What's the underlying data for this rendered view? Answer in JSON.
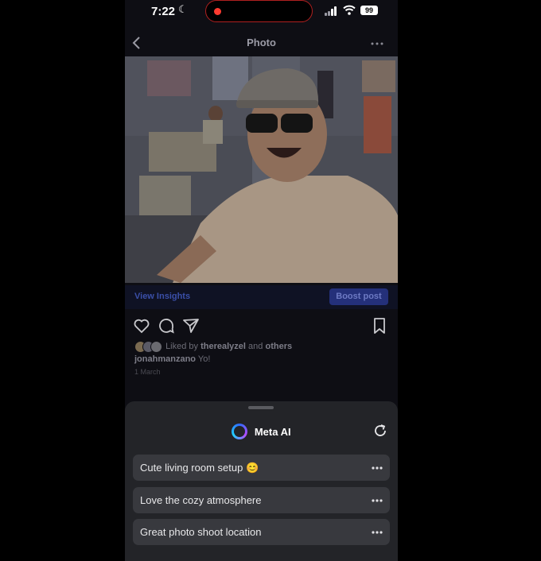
{
  "status_bar": {
    "time": "7:22",
    "battery": "99"
  },
  "nav": {
    "title": "Photo",
    "back_icon": "chevron-left-icon",
    "more_icon": "more-horizontal-icon"
  },
  "post": {
    "view_insights": "View Insights",
    "boost_post": "Boost post",
    "likes_prefix": "Liked by",
    "liked_by_user": "therealyzel",
    "likes_joiner": "and",
    "likes_others": "others",
    "caption_user": "jonahmanzano",
    "caption_text": "Yo!",
    "date": "1 March"
  },
  "meta_ai": {
    "title": "Meta AI",
    "suggestions": [
      {
        "text": "Cute living room setup 😊"
      },
      {
        "text": "Love the cozy atmosphere"
      },
      {
        "text": "Great photo shoot location"
      }
    ]
  },
  "colors": {
    "boost": "#24307a",
    "insights": "#3a4fa8",
    "sheet": "#232428",
    "suggestion": "#38393e"
  }
}
